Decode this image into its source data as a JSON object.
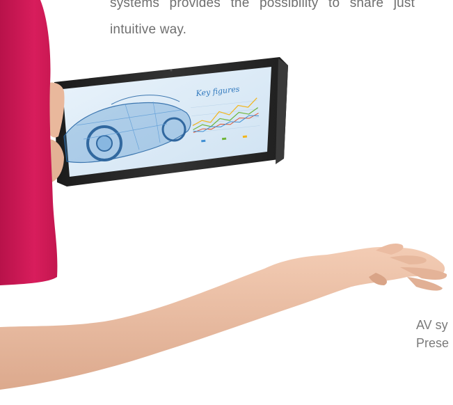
{
  "intro": {
    "line1": "systems provides the possibility to share just",
    "line2": "intuitive way."
  },
  "tablet_screen": {
    "title": "Key figures",
    "line_colors": [
      "#f2b51c",
      "#6fb53a",
      "#e0552f",
      "#3f8fd3"
    ]
  },
  "caption": {
    "line1": "AV sy",
    "line2": "Prese"
  },
  "colors": {
    "sleeve": "#d81d5c",
    "skin": "#eec0a6",
    "tablet_frame": "#242424",
    "screen_bg": "#dfeefa",
    "text": "#6f6f6f"
  }
}
